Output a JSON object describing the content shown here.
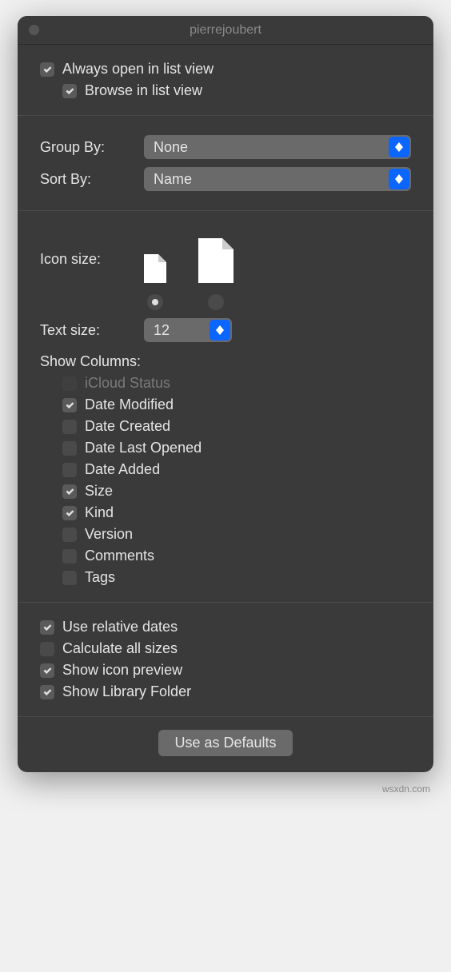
{
  "window": {
    "title": "pierrejoubert"
  },
  "top": {
    "always_open_label": "Always open in list view",
    "always_open_checked": true,
    "browse_label": "Browse in list view",
    "browse_checked": true
  },
  "grouping": {
    "group_by_label": "Group By:",
    "group_by_value": "None",
    "sort_by_label": "Sort By:",
    "sort_by_value": "Name"
  },
  "icon_size": {
    "label": "Icon size:",
    "selected": "small"
  },
  "text_size": {
    "label": "Text size:",
    "value": "12"
  },
  "columns": {
    "heading": "Show Columns:",
    "items": [
      {
        "label": "iCloud Status",
        "checked": false,
        "disabled": true
      },
      {
        "label": "Date Modified",
        "checked": true,
        "disabled": false
      },
      {
        "label": "Date Created",
        "checked": false,
        "disabled": false
      },
      {
        "label": "Date Last Opened",
        "checked": false,
        "disabled": false
      },
      {
        "label": "Date Added",
        "checked": false,
        "disabled": false
      },
      {
        "label": "Size",
        "checked": true,
        "disabled": false
      },
      {
        "label": "Kind",
        "checked": true,
        "disabled": false
      },
      {
        "label": "Version",
        "checked": false,
        "disabled": false
      },
      {
        "label": "Comments",
        "checked": false,
        "disabled": false
      },
      {
        "label": "Tags",
        "checked": false,
        "disabled": false
      }
    ]
  },
  "bottom_opts": [
    {
      "label": "Use relative dates",
      "checked": true
    },
    {
      "label": "Calculate all sizes",
      "checked": false
    },
    {
      "label": "Show icon preview",
      "checked": true
    },
    {
      "label": "Show Library Folder",
      "checked": true
    }
  ],
  "footer": {
    "button_label": "Use as Defaults"
  },
  "watermark": "wsxdn.com"
}
